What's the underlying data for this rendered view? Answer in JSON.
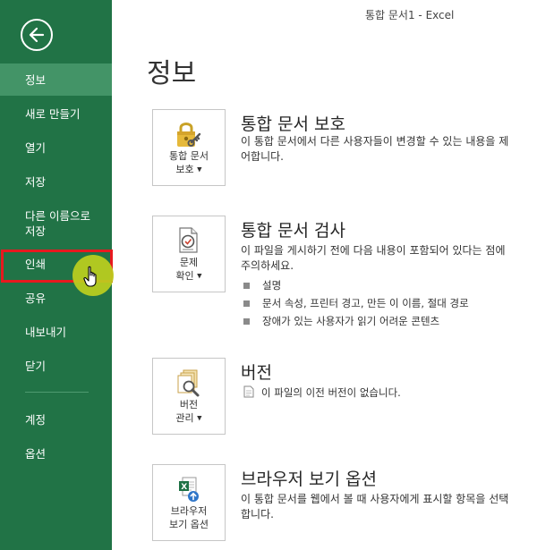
{
  "window": {
    "title": "통합 문서1 - Excel"
  },
  "sidebar": {
    "items": [
      {
        "label": "정보"
      },
      {
        "label": "새로 만들기"
      },
      {
        "label": "열기"
      },
      {
        "label": "저장"
      },
      {
        "label": "다른 이름으로 저장"
      },
      {
        "label": "인쇄"
      },
      {
        "label": "공유"
      },
      {
        "label": "내보내기"
      },
      {
        "label": "닫기"
      },
      {
        "label": "계정"
      },
      {
        "label": "옵션"
      }
    ]
  },
  "main": {
    "title": "정보",
    "sections": [
      {
        "tile_line1": "통합 문서",
        "tile_line2": "보호",
        "title": "통합 문서 보호",
        "description": "이 통합 문서에서 다른 사용자들이 변경할 수 있는 내용을 제어합니다."
      },
      {
        "tile_line1": "문제",
        "tile_line2": "확인",
        "title": "통합 문서 검사",
        "description": "이 파일을 게시하기 전에 다음 내용이 포함되어 있다는 점에 주의하세요.",
        "bullets": [
          "설명",
          "문서 속성, 프린터 경고, 만든 이 이름, 절대 경로",
          "장애가 있는 사용자가 읽기 어려운 콘텐츠"
        ]
      },
      {
        "tile_line1": "버전",
        "tile_line2": "관리",
        "title": "버전",
        "note": "이 파일의 이전 버전이 없습니다."
      },
      {
        "tile_line1": "브라우저",
        "tile_line2": "보기 옵션",
        "title": "브라우저 보기 옵션",
        "description": "이 통합 문서를 웹에서 볼 때 사용자에게 표시할 항목을 선택합니다."
      }
    ]
  },
  "colors": {
    "sidebar_bg": "#217346",
    "sidebar_active": "#439467",
    "highlight": "#e8191f",
    "cursor_halo": "#bdcf1e"
  },
  "icons": [
    "back-arrow-icon",
    "lock-key-icon",
    "inspect-document-icon",
    "manage-versions-icon",
    "browser-view-options-icon",
    "hand-pointer-icon",
    "document-icon"
  ]
}
